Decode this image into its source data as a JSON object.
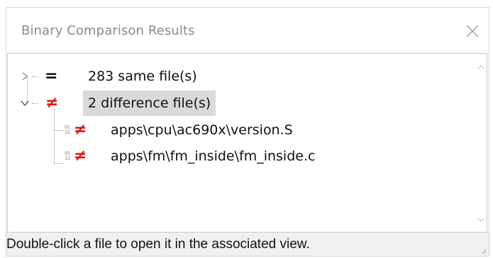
{
  "dialog": {
    "title": "Binary Comparison Results",
    "close_icon": "close-icon"
  },
  "tree": {
    "same": {
      "symbol": "=",
      "label": "283 same file(s)",
      "expanded": false
    },
    "diff": {
      "symbol": "≠",
      "label": "2 difference file(s)",
      "expanded": true,
      "selected": true,
      "files": [
        {
          "symbol": "≠",
          "icon": "binary-file-icon",
          "label": "apps\\cpu\\ac690x\\version.S"
        },
        {
          "symbol": "≠",
          "icon": "binary-file-icon",
          "label": "apps\\fm\\fm_inside\\fm_inside.c"
        }
      ]
    }
  },
  "statusbar": {
    "text": "Double-click a file to open it in the associated view."
  },
  "colors": {
    "difference": "#e01515",
    "selection": "#dadada",
    "title": "#8a8a8a",
    "statusbar_bg": "#f0f0f0"
  }
}
